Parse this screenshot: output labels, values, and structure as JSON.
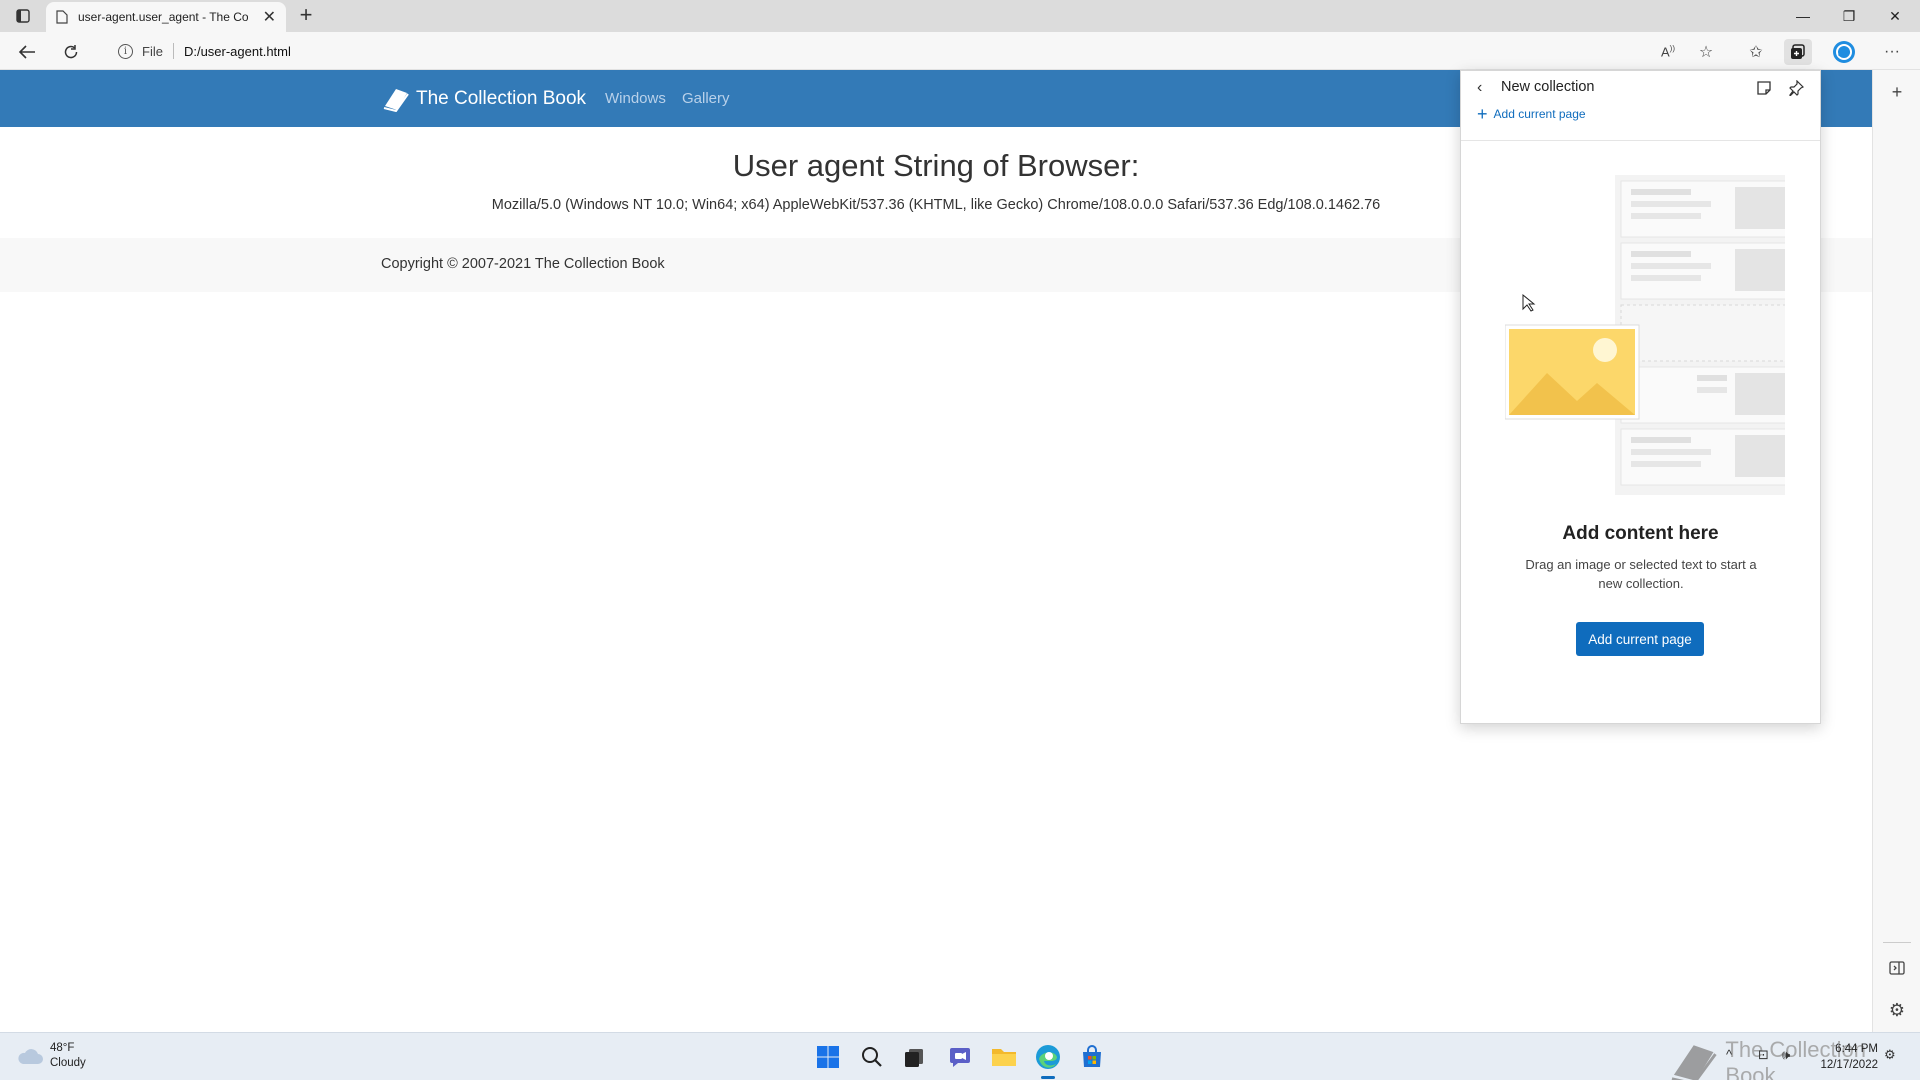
{
  "browser": {
    "tab_title": "user-agent.user_agent - The Collection Book",
    "address_protocol": "File",
    "address_url": "D:/user-agent.html"
  },
  "site": {
    "brand": "The Collection Book",
    "nav": [
      "Windows",
      "Gallery"
    ],
    "page_title": "User agent String of Browser:",
    "user_agent": "Mozilla/5.0 (Windows NT 10.0; Win64; x64) AppleWebKit/537.36 (KHTML, like Gecko) Chrome/108.0.0.0 Safari/537.36 Edg/108.0.1462.76",
    "copyright": "Copyright © 2007-2021 The Collection Book",
    "header_color": "#337ab7"
  },
  "collections": {
    "title": "New collection",
    "add_link": "Add current page",
    "empty_title": "Add content here",
    "empty_desc": "Drag an image or selected text to start a new collection.",
    "add_button": "Add current page",
    "accent_color": "#0f6cbd"
  },
  "taskbar": {
    "weather_temp": "48°F",
    "weather_cond": "Cloudy",
    "time": "6:44 PM",
    "date": "12/17/2022",
    "watermark": "The Collection Book"
  }
}
